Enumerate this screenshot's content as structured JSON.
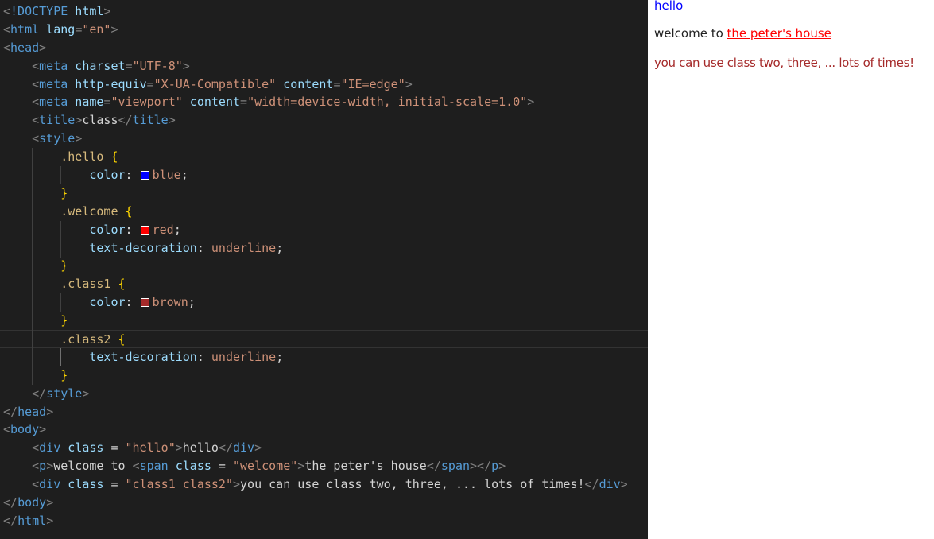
{
  "editor": {
    "lines": [
      [
        "<",
        "!DOCTYPE",
        " html",
        ">"
      ],
      [
        "<",
        "html",
        " lang",
        "=",
        "\"en\"",
        ">"
      ],
      [
        "<",
        "head",
        ">"
      ],
      [
        "<",
        "meta",
        " charset",
        "=",
        "\"UTF-8\"",
        ">"
      ],
      [
        "<",
        "meta",
        " http-equiv",
        "=",
        "\"X-UA-Compatible\"",
        " content",
        "=",
        "\"IE=edge\"",
        ">"
      ],
      [
        "<",
        "meta",
        " name",
        "=",
        "\"viewport\"",
        " content",
        "=",
        "\"width=device-width, initial-scale=1.0\"",
        ">"
      ],
      [
        "<",
        "title",
        ">",
        "class",
        "</",
        "title",
        ">"
      ],
      [
        "<",
        "style",
        ">"
      ],
      [
        ".hello",
        " {"
      ],
      [
        "color",
        ": ",
        "blue",
        ";"
      ],
      [
        "}"
      ],
      [
        ".welcome",
        " {"
      ],
      [
        "color",
        ": ",
        "red",
        ";"
      ],
      [
        "text-decoration",
        ": ",
        "underline",
        ";"
      ],
      [
        "}"
      ],
      [
        ".class1",
        " {"
      ],
      [
        "color",
        ": ",
        "brown",
        ";"
      ],
      [
        "}"
      ],
      [
        ".class2",
        " {"
      ],
      [
        "text-decoration",
        ": ",
        "underline",
        ";"
      ],
      [
        "}"
      ],
      [
        "</",
        "style",
        ">"
      ],
      [
        "</",
        "head",
        ">"
      ],
      [
        "<",
        "body",
        ">"
      ],
      [
        "<",
        "div",
        " class",
        " = ",
        "\"hello\"",
        ">",
        "hello",
        "</",
        "div",
        ">"
      ],
      [
        "<",
        "p",
        ">",
        "welcome to ",
        "<",
        "span",
        " class",
        " = ",
        "\"welcome\"",
        ">",
        "the peter's house",
        "</",
        "span",
        "></",
        "p",
        ">"
      ],
      [
        "<",
        "div",
        " class",
        " = ",
        "\"class1 class2\"",
        ">",
        "you can use class two, three, ... lots of times!",
        "</",
        "div",
        ">"
      ],
      [
        "</",
        "body",
        ">"
      ],
      [
        "</",
        "html",
        ">"
      ]
    ],
    "swatches": {
      "blue": "#0000ff",
      "red": "#ff0000",
      "brown": "#a52a2a"
    }
  },
  "preview": {
    "hello_text": "hello",
    "welcome_prefix": "welcome to ",
    "welcome_span": "the peter's house",
    "class_text": "you can use class two, three, ... lots of times!",
    "colors": {
      "hello": "#0000ff",
      "welcome": "#ff0000",
      "class1": "#a52a2a"
    }
  }
}
